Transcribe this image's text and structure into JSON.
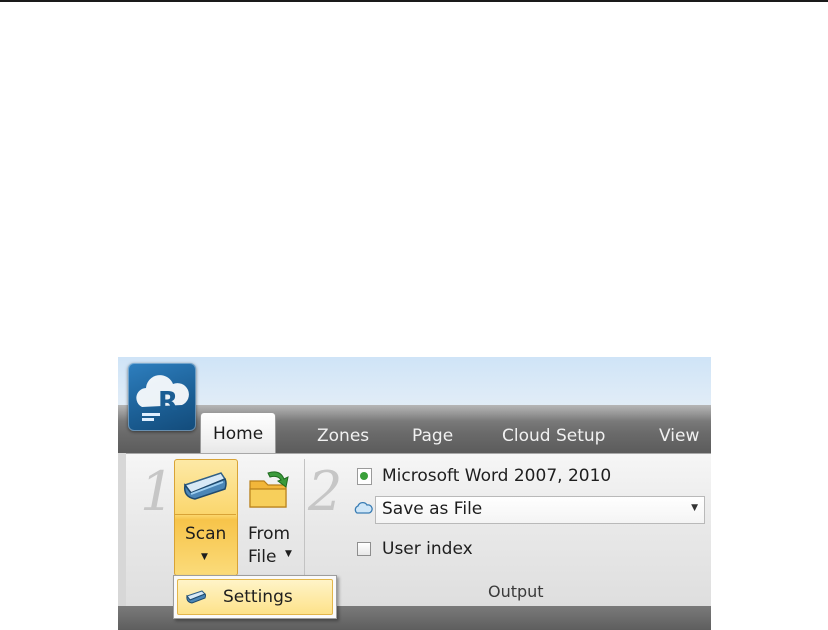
{
  "app": {
    "logo_letter": "R"
  },
  "tabs": [
    {
      "label": "Home",
      "active": true
    },
    {
      "label": "Zones"
    },
    {
      "label": "Page"
    },
    {
      "label": "Cloud Setup"
    },
    {
      "label": "View"
    }
  ],
  "steps": {
    "input_number": "1",
    "output_number": "2"
  },
  "input_group": {
    "scan_button_label": "Scan",
    "from_file_label_line1": "From",
    "from_file_label_line2": "File"
  },
  "output_group": {
    "format": "Microsoft Word 2007, 2010",
    "destination": "Save as File",
    "user_index_label": "User index",
    "user_index_checked": false,
    "group_label": "Output"
  },
  "scan_menu": {
    "items": [
      {
        "label": "Settings",
        "icon": "scanner-icon"
      }
    ]
  },
  "colors": {
    "accent_highlight": "#fbd66c",
    "tab_strip": "#6b6b6b",
    "logo_blue": "#1b5e94"
  }
}
